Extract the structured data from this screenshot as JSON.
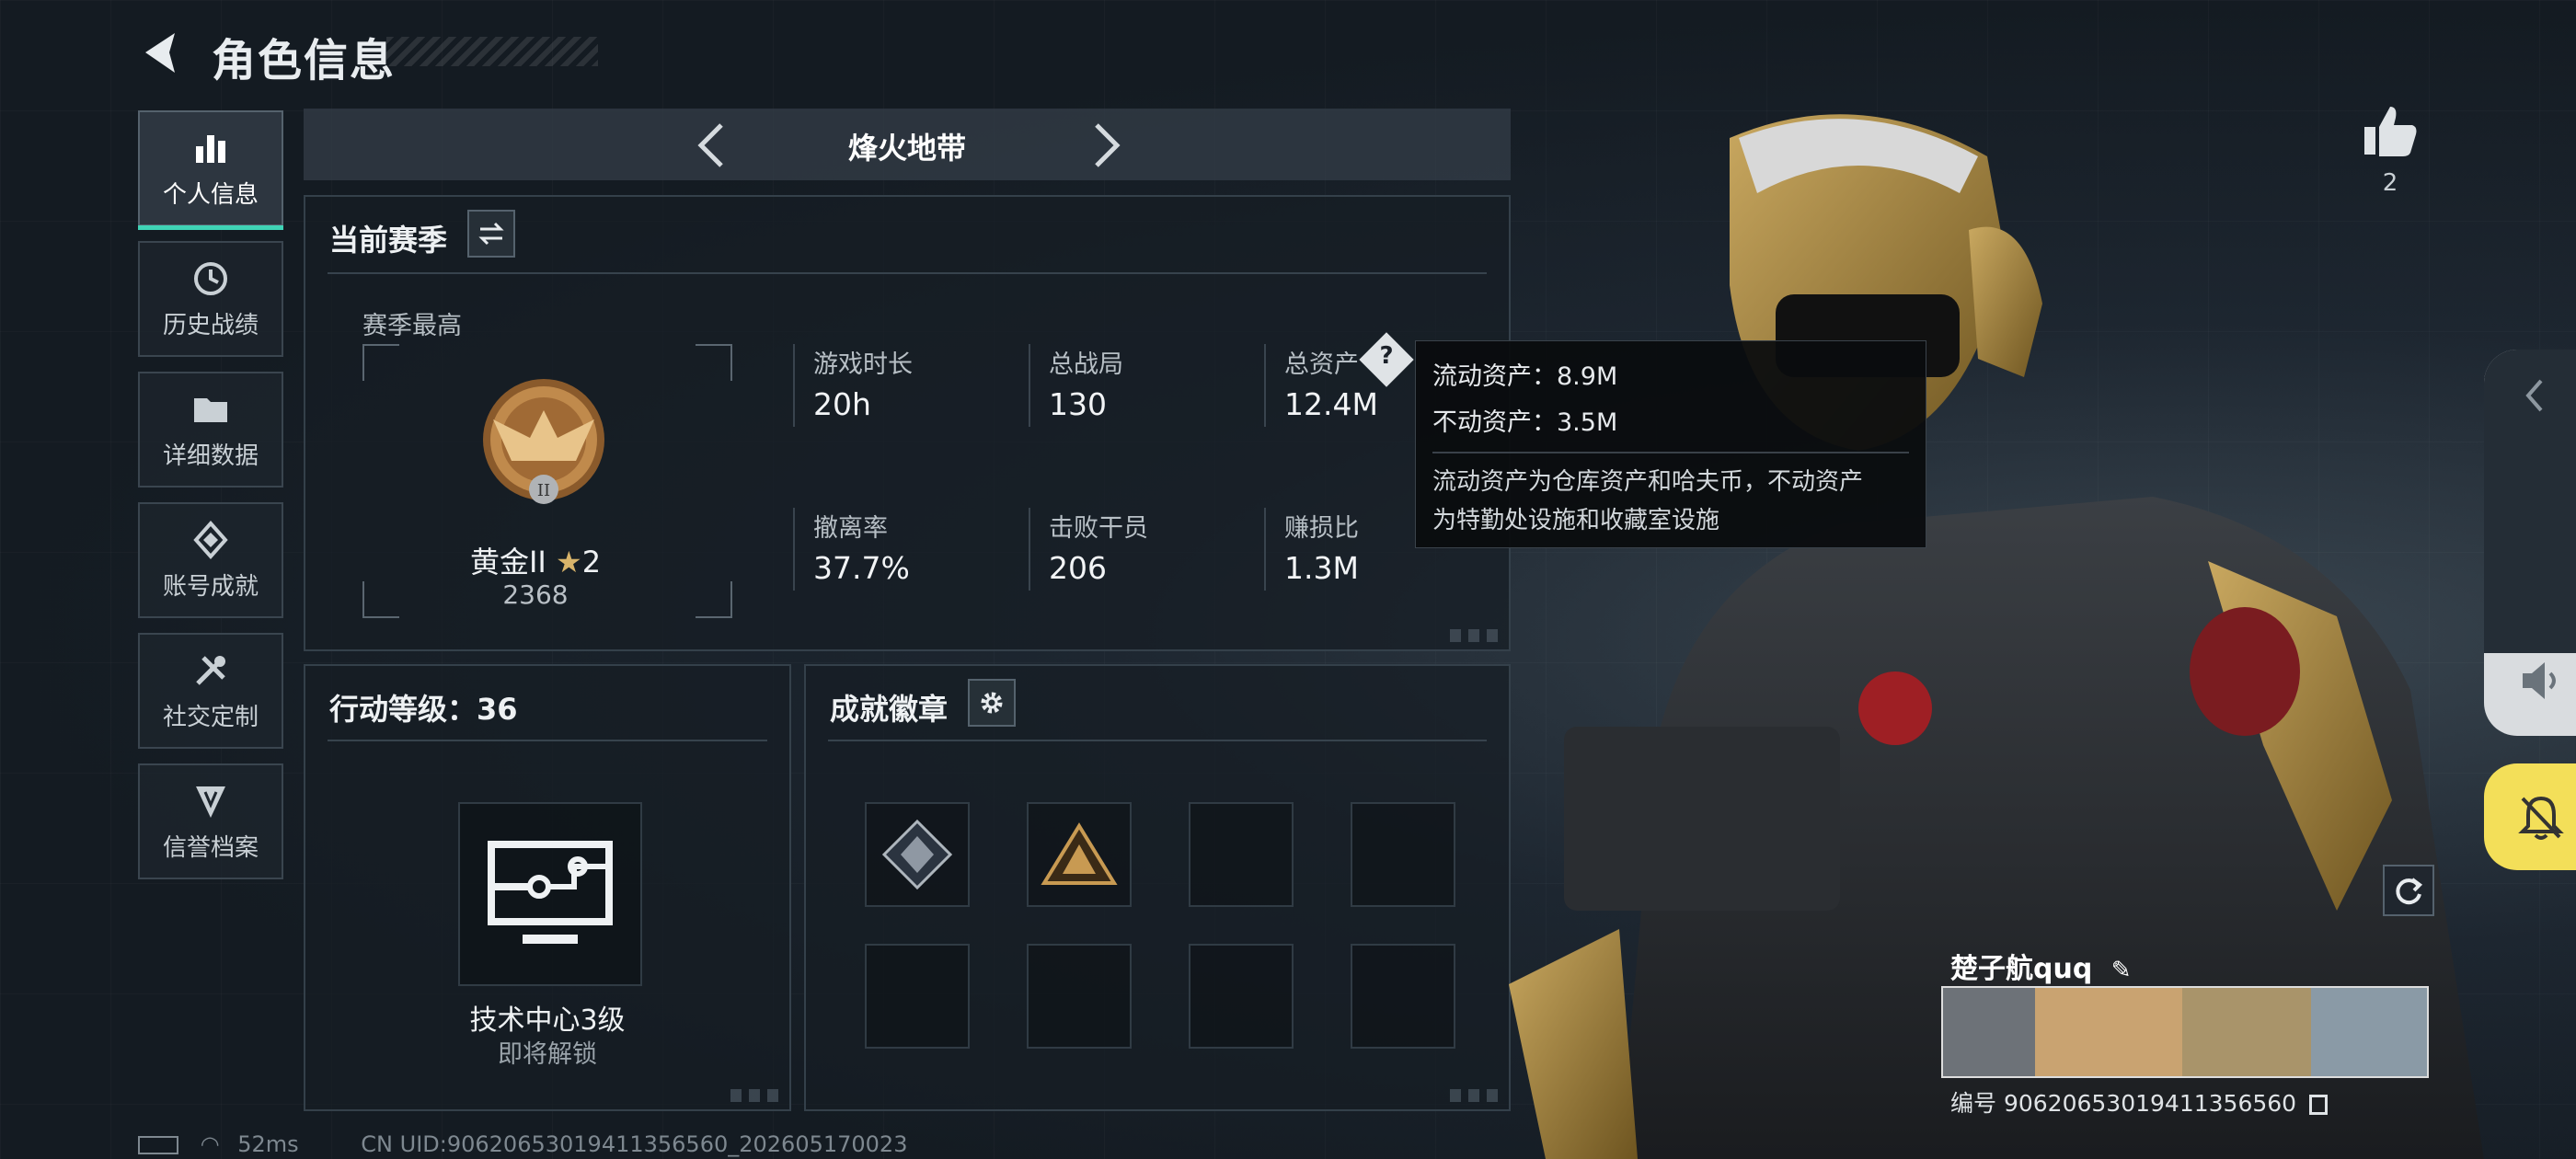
{
  "header": {
    "title": "角色信息"
  },
  "sidebar": {
    "items": [
      {
        "label": "个人信息",
        "icon": "bar-chart-icon",
        "active": true
      },
      {
        "label": "历史战绩",
        "icon": "history-icon",
        "active": false
      },
      {
        "label": "详细数据",
        "icon": "folder-icon",
        "active": false
      },
      {
        "label": "账号成就",
        "icon": "achievement-icon",
        "active": false
      },
      {
        "label": "社交定制",
        "icon": "tools-icon",
        "active": false
      },
      {
        "label": "信誉档案",
        "icon": "shield-icon",
        "active": false
      }
    ]
  },
  "season_selector": {
    "name": "烽火地带"
  },
  "current_season": {
    "title": "当前赛季",
    "best_label": "赛季最高",
    "rank_name": "黄金II",
    "rank_stars": "2",
    "rank_score": "2368",
    "stats": [
      {
        "label": "游戏时长",
        "value": "20h"
      },
      {
        "label": "总战局",
        "value": "130"
      },
      {
        "label": "总资产",
        "value": "12.4M"
      },
      {
        "label": "撤离率",
        "value": "37.7%"
      },
      {
        "label": "击败干员",
        "value": "206"
      },
      {
        "label": "赚损比",
        "value": "1.3M"
      }
    ]
  },
  "tooltip": {
    "liquid": "流动资产：8.9M",
    "fixed": "不动资产：3.5M",
    "desc_line1": "流动资产为仓库资产和哈夫币，不动资产",
    "desc_line2": "为特勤处设施和收藏室设施"
  },
  "action_level": {
    "title": "行动等级：36",
    "unlock_name": "技术中心3级",
    "unlock_status": "即将解锁"
  },
  "badges": {
    "title": "成就徽章"
  },
  "likes": {
    "count": "2"
  },
  "player": {
    "name": "楚子航quq",
    "id_text": "编号 9062065301941135656​0"
  },
  "status_bar": {
    "ping": "52ms",
    "uid": "CN UID:9062065301941135656​0_202605170023"
  },
  "colors": {
    "accent": "#3fd4b6",
    "bell": "#f3df59"
  }
}
